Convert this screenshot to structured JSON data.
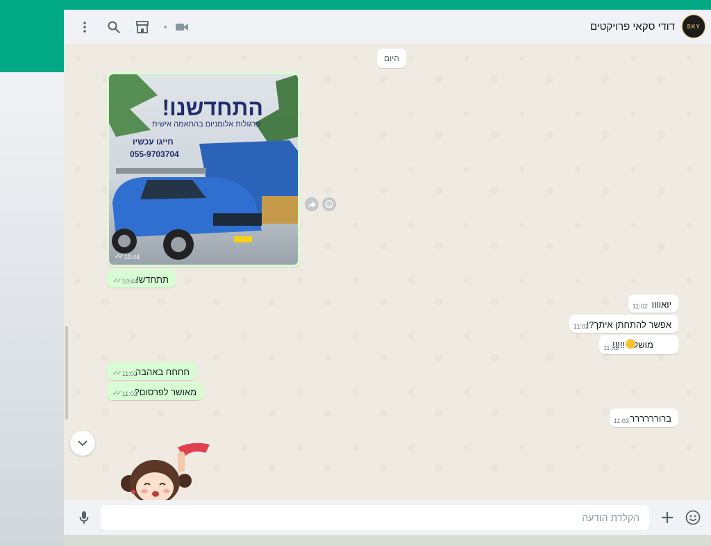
{
  "header": {
    "contact_name": "דודי סקאי פרויקטים",
    "avatar_text": "SKY",
    "icons": [
      "menu-icon",
      "search-icon",
      "store-icon",
      "video-call-icon"
    ]
  },
  "chat": {
    "date_label": "היום",
    "image_message": {
      "headline": "התחדשנו!",
      "subline": "פרגולות אלומניום בהתאמה אישית",
      "cta": "חייגו עכשיו",
      "phone": "055-9703704",
      "time": "10:44"
    },
    "messages": [
      {
        "direction": "out",
        "text": "תתחדש!",
        "time": "10:44"
      },
      {
        "direction": "in",
        "text": "יואוווו",
        "time": "11:02"
      },
      {
        "direction": "in",
        "text": "אפשר להתחתן איתך?!",
        "time": "11:02"
      },
      {
        "direction": "in",
        "text": "מושלם !!!!!",
        "time": "11:02"
      },
      {
        "direction": "out",
        "text": "חחחח באהבה",
        "time": "11:02"
      },
      {
        "direction": "out",
        "text": "מאושר לפרסום?",
        "time": "11:02"
      },
      {
        "direction": "in",
        "text": "ברורררררר",
        "time": "11:03"
      }
    ]
  },
  "composer": {
    "placeholder": "הקלדת הודעה"
  },
  "colors": {
    "accent": "#00a884",
    "outgoing_bubble": "#d9fdd3",
    "incoming_bubble": "#ffffff",
    "chat_background": "#efeae2"
  }
}
